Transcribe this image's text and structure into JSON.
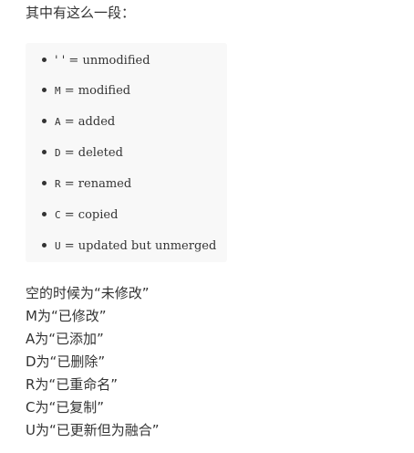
{
  "intro": "其中有这么一段：",
  "status_codes": [
    {
      "code": "' '",
      "sep": " = ",
      "desc": "unmodified"
    },
    {
      "code": "M",
      "sep": " = ",
      "desc": "modified"
    },
    {
      "code": "A",
      "sep": " = ",
      "desc": "added"
    },
    {
      "code": "D",
      "sep": " = ",
      "desc": "deleted"
    },
    {
      "code": "R",
      "sep": " = ",
      "desc": "renamed"
    },
    {
      "code": "C",
      "sep": " = ",
      "desc": "copied"
    },
    {
      "code": "U",
      "sep": " = ",
      "desc": "updated but unmerged"
    }
  ],
  "explanations": [
    "空的时候为“未修改”",
    "M为“已修改”",
    "A为“已添加”",
    "D为“已删除”",
    "R为“已重命名”",
    "C为“已复制”",
    "U为“已更新但为融合”"
  ]
}
